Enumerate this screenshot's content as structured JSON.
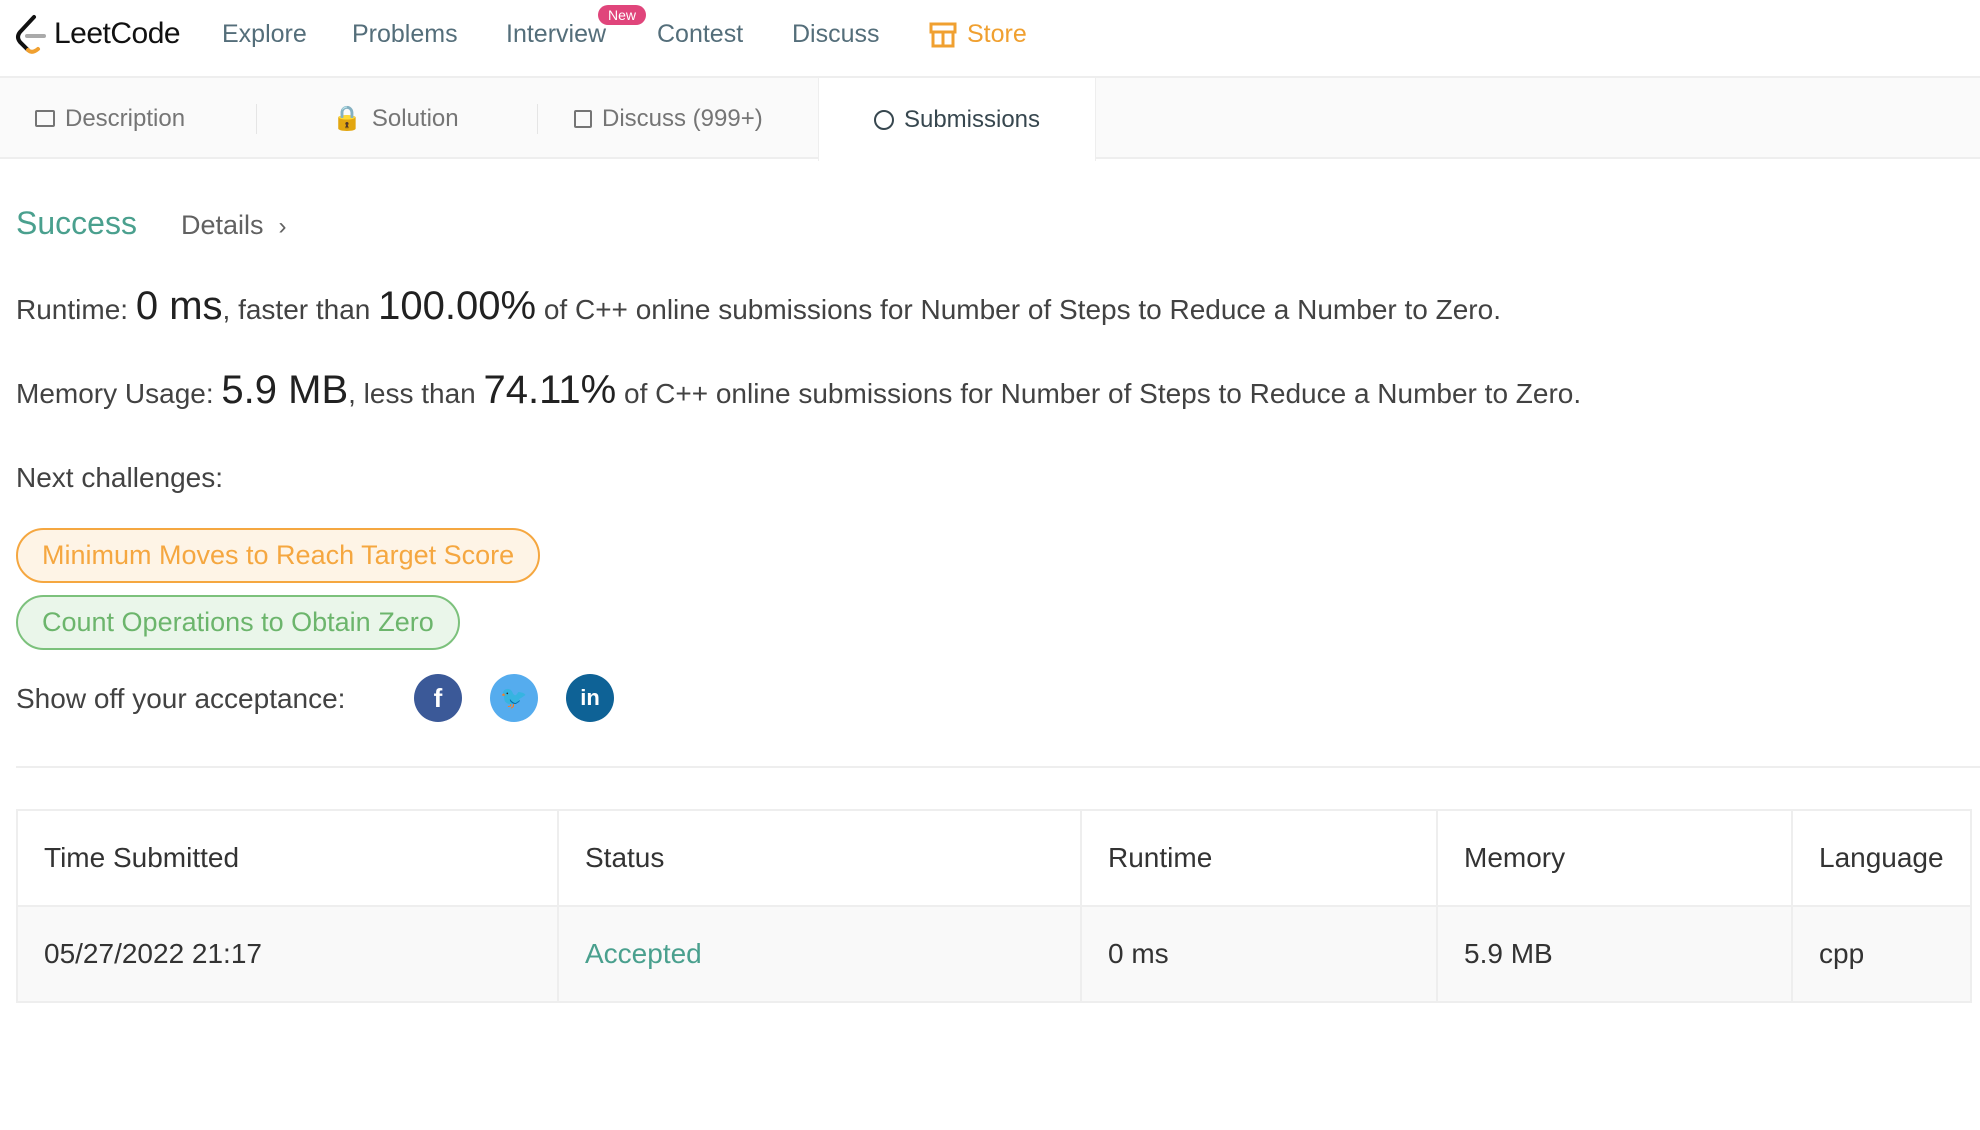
{
  "nav": {
    "logo": "LeetCode",
    "items": [
      "Explore",
      "Problems",
      "Interview",
      "Contest",
      "Discuss"
    ],
    "badge": "New",
    "store": "Store"
  },
  "tabs": [
    "Description",
    "Solution",
    "Discuss (999+)",
    "Submissions"
  ],
  "result": {
    "status": "Success",
    "details": "Details",
    "details_chevron": "›",
    "runtime_label": "Runtime: ",
    "runtime": "0 ms",
    "runtime_mid": ", faster than ",
    "runtime_pct": "100.00%",
    "runtime_tail": " of C++ online submissions for Number of Steps to Reduce a Number to Zero.",
    "memory_label": "Memory Usage: ",
    "memory": "5.9 MB",
    "memory_mid": ", less than ",
    "memory_pct": "74.11%",
    "memory_tail": " of C++ online submissions for Number of Steps to Reduce a Number to Zero."
  },
  "next": {
    "label": "Next challenges:",
    "items": [
      "Minimum Moves to Reach Target Score",
      "Count Operations to Obtain Zero"
    ]
  },
  "share": {
    "label": "Show off your acceptance:",
    "icons": [
      "facebook-icon",
      "twitter-icon",
      "linkedin-icon"
    ],
    "colors": [
      "#3b5998",
      "#55acee",
      "#0e6296"
    ]
  },
  "table": {
    "headers": [
      "Time Submitted",
      "Status",
      "Runtime",
      "Memory",
      "Language"
    ],
    "rows": [
      [
        "05/27/2022 21:17",
        "Accepted",
        "0 ms",
        "5.9 MB",
        "cpp"
      ]
    ]
  },
  "colors": {
    "success": "#4aa08e",
    "store": "#f0a030",
    "badge": "#e0457b"
  }
}
